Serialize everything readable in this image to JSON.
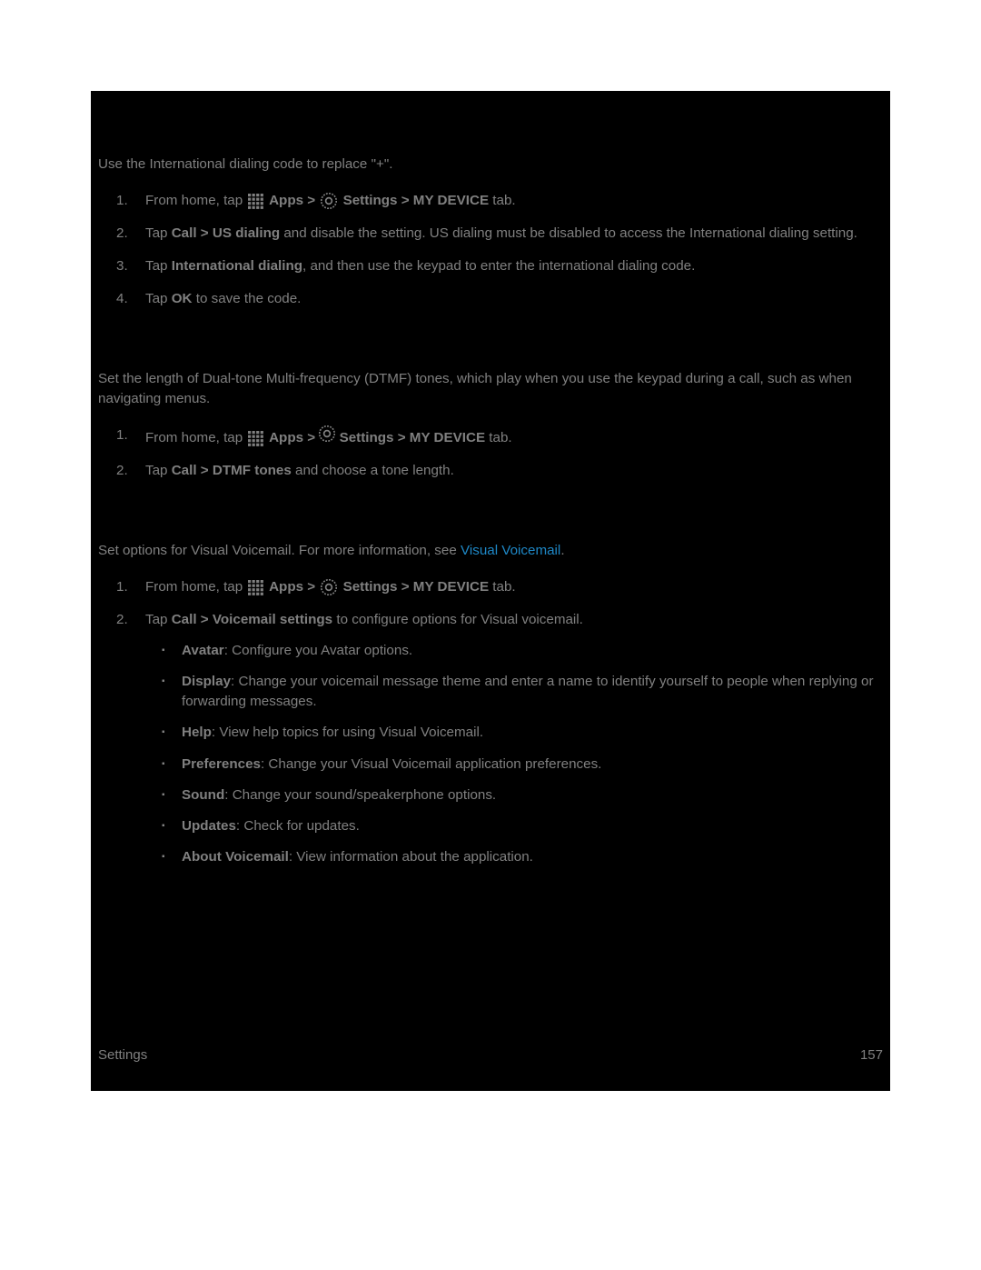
{
  "section1": {
    "intro": "Use the International dialing code to replace \"+\".",
    "step1_a": "From home, tap ",
    "step1_apps": " Apps > ",
    "step1_settings": " Settings > MY DEVICE",
    "step1_tab": " tab.",
    "step2_a": "Tap ",
    "step2_call": "Call > US dialing",
    "step2_b": " and disable the setting. US dialing must be disabled to access the International dialing setting.",
    "step3_a": "Tap ",
    "step3_intl": "International dialing",
    "step3_b": ", and then use the keypad to enter the international dialing code.",
    "step4_a": "Tap ",
    "step4_ok": "OK",
    "step4_b": " to save the code."
  },
  "section2": {
    "intro": "Set the length of Dual-tone Multi-frequency (DTMF) tones, which play when you use the keypad during a call, such as when navigating menus.",
    "step1_a": "From home, tap ",
    "step1_apps": " Apps > ",
    "step1_settings": " Settings > MY DEVICE",
    "step1_tab": " tab.",
    "step2_a": "Tap ",
    "step2_dtmf": "Call > DTMF tones",
    "step2_b": " and choose a tone length."
  },
  "section3": {
    "intro_a": "Set options for Visual Voicemail. For more information, see ",
    "intro_link": "Visual Voicemail",
    "intro_b": ".",
    "step1_a": "From home, tap ",
    "step1_apps": " Apps > ",
    "step1_settings": " Settings > MY DEVICE",
    "step1_tab": " tab.",
    "step2_a": "Tap ",
    "step2_vm": "Call > Voicemail settings",
    "step2_b": " to configure options for Visual voicemail.",
    "bullets": {
      "avatar_b": "Avatar",
      "avatar_t": ": Configure you Avatar options.",
      "display_b": "Display",
      "display_t": ": Change your voicemail message theme and enter a name to identify yourself to people when replying or forwarding messages.",
      "help_b": "Help",
      "help_t": ": View help topics for using Visual Voicemail.",
      "pref_b": "Preferences",
      "pref_t": ": Change your Visual Voicemail application preferences.",
      "sound_b": "Sound",
      "sound_t": ": Change your sound/speakerphone options.",
      "updates_b": "Updates",
      "updates_t": ": Check for updates.",
      "about_b": "About Voicemail",
      "about_t": ": View information about the application."
    }
  },
  "footer": {
    "section": "Settings",
    "page": "157"
  }
}
